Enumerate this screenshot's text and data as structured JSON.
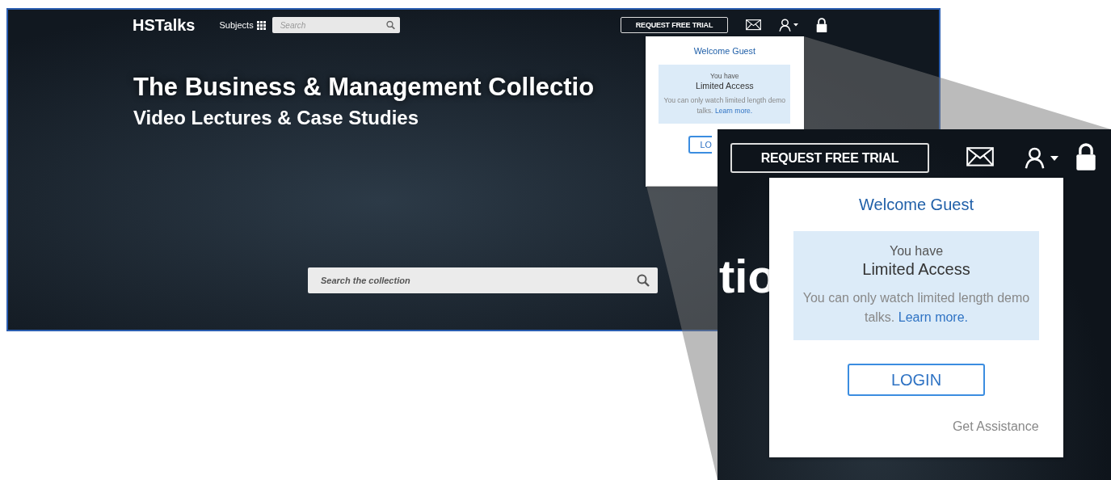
{
  "page": {
    "logo": "HSTalks",
    "subjects_label": "Subjects",
    "search": {
      "placeholder": "Search"
    },
    "trial_button": "REQUEST FREE TRIAL",
    "hero_title": "The Business & Management Collectio",
    "hero_subtitle": "Video Lectures & Case Studies",
    "collection_search": {
      "placeholder": "Search the collection"
    },
    "account_menu": {
      "title": "Welcome Guest",
      "access_intro": "You have",
      "access_level": "Limited Access",
      "access_note": "You can only watch limited length demo talks.",
      "learn_more": "Learn more.",
      "login_button": "LO"
    }
  },
  "zoom_inset": {
    "trial_button": "REQUEST FREE TRIAL",
    "hero_title_fragment": "tio",
    "account_menu": {
      "title": "Welcome Guest",
      "access_intro": "You have",
      "access_level": "Limited Access",
      "access_note": "You can only watch limited length demo talks.",
      "learn_more": "Learn more.",
      "login_button": "LOGIN",
      "assistance_link": "Get Assistance"
    }
  }
}
